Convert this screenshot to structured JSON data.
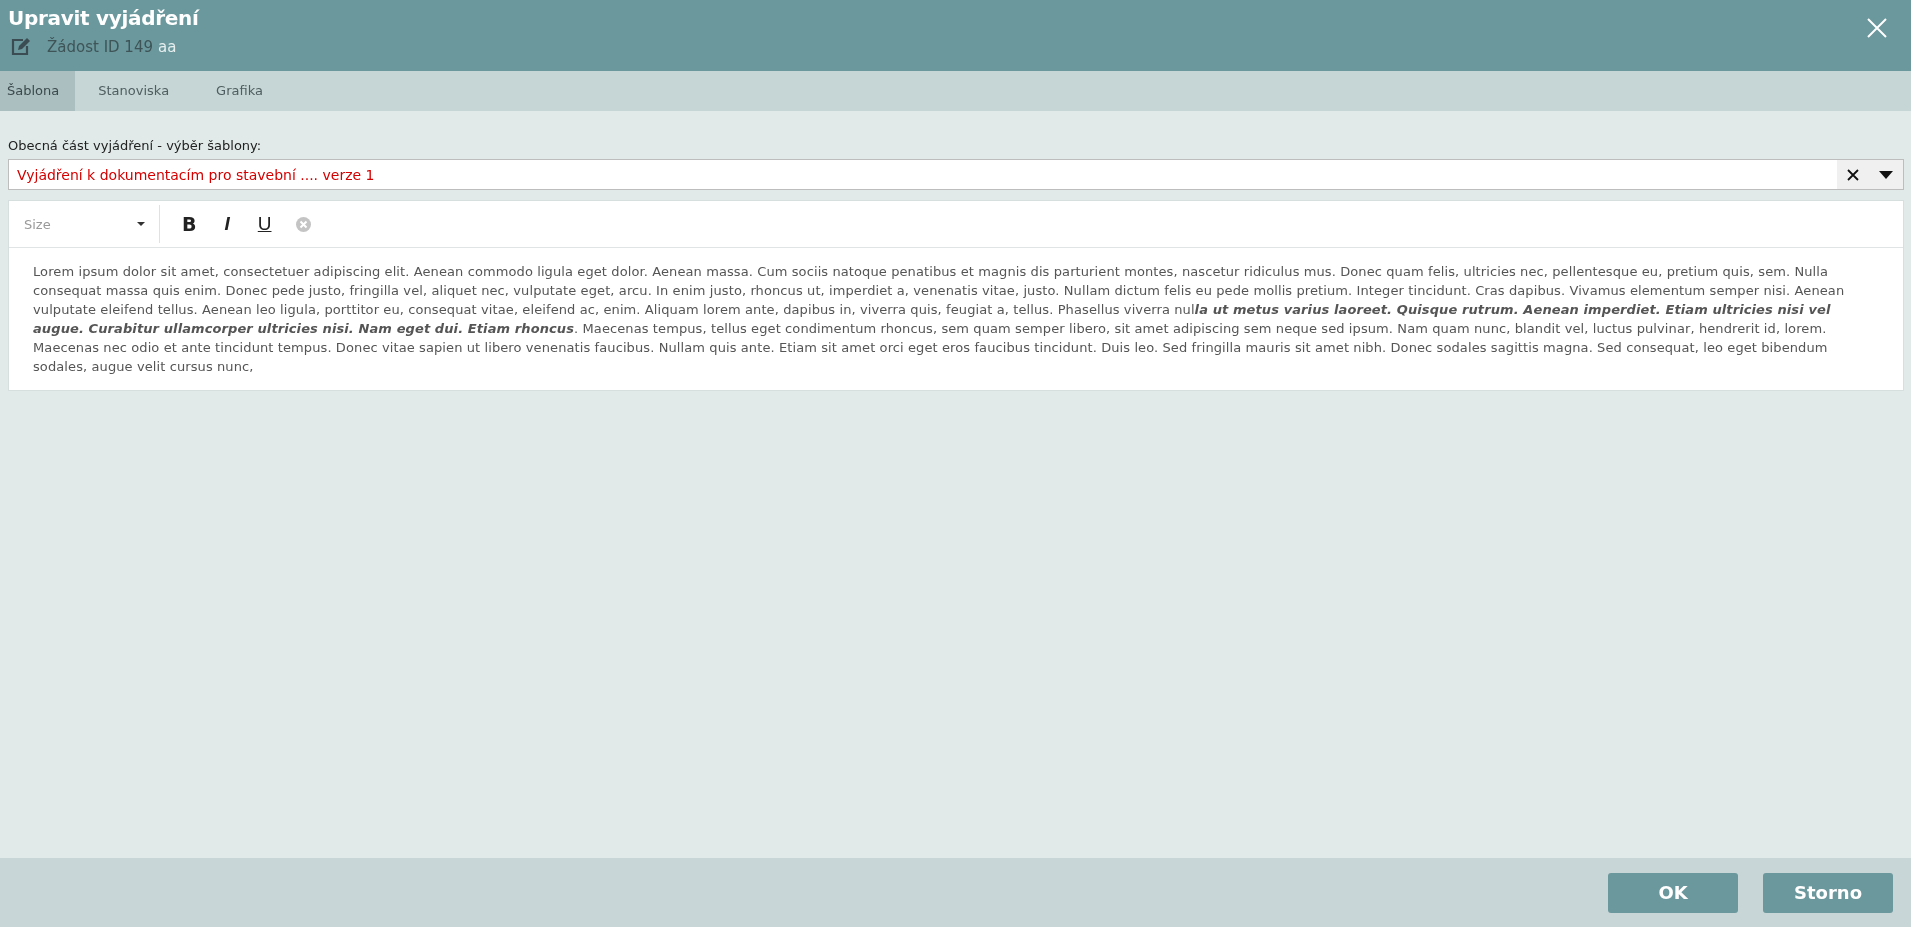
{
  "window": {
    "title": "Upravit vyjádření",
    "subtitle": "Žádost ID 149",
    "subtitle_extra": "aa"
  },
  "tabs": [
    {
      "label": "Šablona",
      "selected": true
    },
    {
      "label": "Stanoviska",
      "selected": false
    },
    {
      "label": "Grafika",
      "selected": false
    }
  ],
  "template_select": {
    "label": "Obecná část vyjádření - výběr šablony:",
    "value": "Vyjádření k dokumentacím pro stavební .... verze 1"
  },
  "editor": {
    "size_select": {
      "placeholder": "Size"
    },
    "toolbar": [
      {
        "kind": "bold",
        "label": "B"
      },
      {
        "kind": "italic",
        "label": "I"
      },
      {
        "kind": "underline",
        "label": "U"
      },
      {
        "kind": "clear"
      }
    ],
    "text": "Lorem ipsum dolor sit amet, consectetuer adipiscing elit. Aenean commodo ligula eget dolor. Aenean massa. Cum sociis natoque penatibus et magnis dis parturient montes, nascetur ridiculus mus. Donec quam felis, ultricies nec, pellentesque eu, pretium quis, sem. Nulla consequat massa quis enim. Donec pede justo, fringilla vel, aliquet nec, vulputate eget, arcu. In enim justo, rhoncus ut, imperdiet a, venenatis vitae, justo. Nullam dictum felis eu pede mollis pretium. Integer tincidunt. Cras dapibus. Vivamus elementum semper nisi. Aenean vulputate eleifend tellus. Aenean leo ligula, porttitor eu, consequat vitae, eleifend ac, enim. Aliquam lorem ante, dapibus in, viverra quis, feugiat a, tellus. Phasellus viverra nul**la ut metus varius laoreet. Quisque rutrum. Aenean imperdiet. Etiam ultricies nisi vel augue. Curabitur ullamcorper ultricies nisi. Nam eget dui. Etiam rhoncus**. Maecenas tempus, tellus eget condimentum rhoncus, sem quam semper libero, sit amet adipiscing sem neque sed ipsum. Nam quam nunc, blandit vel, luctus pulvinar, hendrerit id, lorem. Maecenas nec odio et ante tincidunt tempus. Donec vitae sapien ut libero venenatis faucibus. Nullam quis ante. Etiam sit amet orci eget eros faucibus tincidunt. Duis leo. Sed fringilla mauris sit amet nibh. Donec sodales sagittis magna. Sed consequat, leo eget bibendum sodales, augue velit cursus nunc,"
  },
  "buttons": [
    "OK",
    "Storno"
  ]
}
